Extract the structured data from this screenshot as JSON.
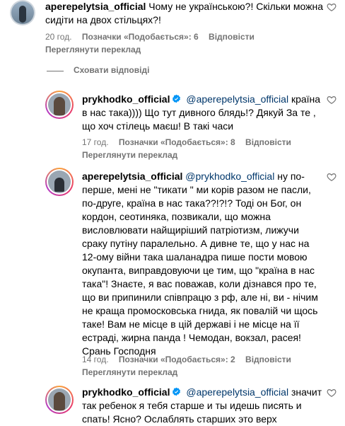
{
  "comments": [
    {
      "username": "aperepelytsia_official",
      "verified": false,
      "text": "Чому не українською?! Скільки можна сидіти на двох стільцях?!",
      "time": "20 год.",
      "likes": "Позначки «Подобається»: 6",
      "reply": "Відповісти",
      "translate": "Переглянути переклад"
    },
    {
      "username": "prykhodko_official",
      "verified": true,
      "mention": "@aperepelytsia_official",
      "text": "країна в нас така)))) Що тут дивного блядь!? Дякуй За те , що хоч стілець маєш! В такі часи",
      "time": "17 год.",
      "likes": "Позначки «Подобається»: 8",
      "reply": "Відповісти",
      "translate": "Переглянути переклад"
    },
    {
      "username": "aperepelytsia_official",
      "verified": false,
      "mention": "@prykhodko_official",
      "text": "ну по-перше, мені не \"тикати \" ми корів разом не пасли, по-друге, країна в нас така??!?!? Тоді он Бог, он кордон, сеотиняка, позвикали, що можна висловлювати найщиріший патріотизм, лижучи сраку путіну паралельно. А дивне те, що у нас на 12-ому війни така шаланадра пише пости мовою окупанта, виправдовуючи це тим, що \"країна в нас така\"! Знаєте, я вас поважав, коли дізнався про те, що ви припинили співпрацю з рф, але ні, ви - нічим не краща промосковська гнида, як повалій чи щось таке! Вам не місце в цій державі і не місце на її естраді, жирна панда ! Чемодан, вокзал, расея! Срань Господня",
      "time": "14 год.",
      "likes": "Позначки «Подобається»: 2",
      "reply": "Відповісти",
      "translate": "Переглянути переклад"
    },
    {
      "username": "prykhodko_official",
      "verified": true,
      "mention": "@aperepelytsia_official",
      "text": "значит так ребенок я тебя старше и ты идешь писять и спать! Ясно? Ослаблять старших это верх"
    }
  ],
  "hide_replies": "Сховати відповіді"
}
